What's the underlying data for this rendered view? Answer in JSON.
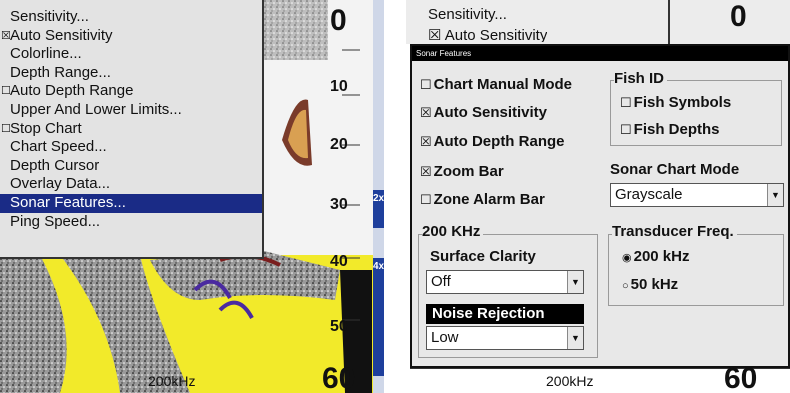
{
  "left": {
    "menu_items": [
      {
        "label": "Sensitivity...",
        "check": "",
        "selected": false
      },
      {
        "label": "Auto Sensitivity",
        "check": "☒",
        "selected": false
      },
      {
        "label": "Colorline...",
        "check": "",
        "selected": false
      },
      {
        "label": "Depth Range...",
        "check": "",
        "selected": false
      },
      {
        "label": "Auto Depth Range",
        "check": "☐",
        "selected": false
      },
      {
        "label": "Upper And Lower Limits...",
        "check": "",
        "selected": false
      },
      {
        "label": "Stop Chart",
        "check": "☐",
        "selected": false
      },
      {
        "label": "Chart Speed...",
        "check": "",
        "selected": false
      },
      {
        "label": "Depth Cursor",
        "check": "",
        "selected": false
      },
      {
        "label": "Overlay Data...",
        "check": "",
        "selected": false
      },
      {
        "label": "Sonar Features...",
        "check": "",
        "selected": true
      },
      {
        "label": "Ping Speed...",
        "check": "",
        "selected": false
      }
    ],
    "depth_top": "0",
    "depth_ticks": [
      "10",
      "20",
      "30",
      "40",
      "50"
    ],
    "depth_bottom": "60",
    "frequency": "200kHz",
    "zoom_marks": [
      "2x",
      "4x"
    ]
  },
  "right": {
    "bg_text_1": "Sensitivity...",
    "bg_text_2": "☒ Auto Sensitivity",
    "bg_depth_top": "0",
    "dialog": {
      "title": "Sonar Features",
      "options": {
        "chart_manual_mode": {
          "label": "Chart Manual Mode",
          "checked": false
        },
        "auto_sensitivity": {
          "label": "Auto Sensitivity",
          "checked": true
        },
        "auto_depth_range": {
          "label": "Auto Depth Range",
          "checked": true
        },
        "zoom_bar": {
          "label": "Zoom Bar",
          "checked": true
        },
        "zone_alarm_bar": {
          "label": "Zone Alarm Bar",
          "checked": false
        }
      },
      "fish_id": {
        "title": "Fish ID",
        "fish_symbols": {
          "label": "Fish Symbols",
          "checked": false
        },
        "fish_depths": {
          "label": "Fish Depths",
          "checked": false
        }
      },
      "sonar_chart_mode": {
        "label": "Sonar Chart Mode",
        "value": "Grayscale"
      },
      "khz_section": {
        "title": "200 KHz",
        "surface_clarity": {
          "label": "Surface Clarity",
          "value": "Off"
        },
        "noise_rejection": {
          "label": "Noise Rejection",
          "value": "Low"
        }
      },
      "transducer_freq": {
        "title": "Transducer Freq.",
        "options": [
          {
            "label": "200 kHz",
            "selected": true
          },
          {
            "label": "50 kHz",
            "selected": false
          }
        ]
      }
    },
    "frequency": "200kHz",
    "depth_bottom": "60"
  },
  "symbols": {
    "checked": "☒",
    "unchecked": "☐",
    "radio_on": "◉",
    "radio_off": "○",
    "dropdown_arrow": "▼"
  }
}
